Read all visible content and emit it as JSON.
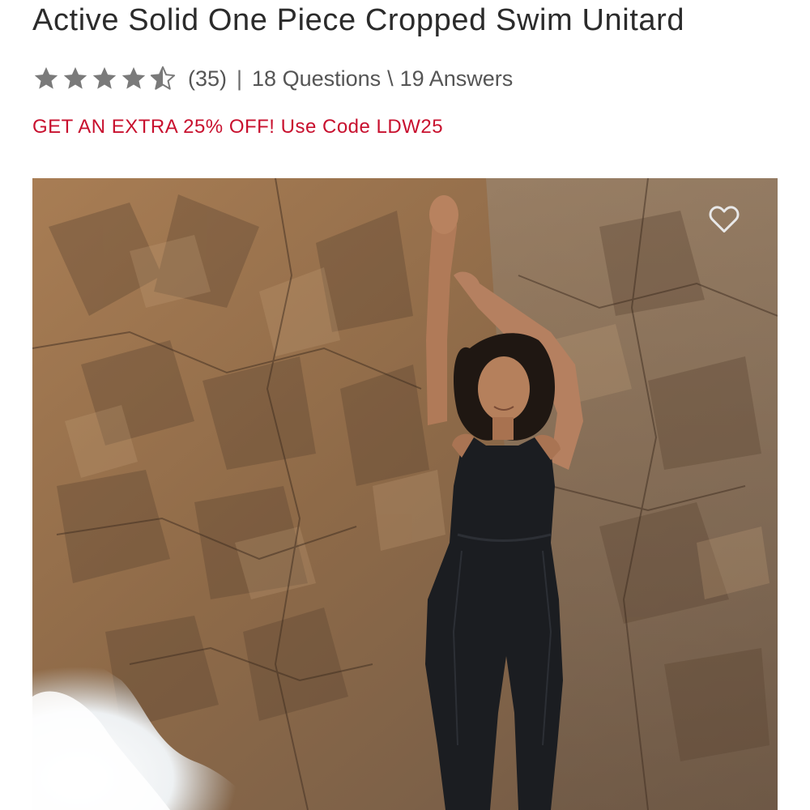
{
  "product": {
    "title": "Active Solid One Piece Cropped Swim Unitard"
  },
  "rating": {
    "stars": 4.5,
    "max_stars": 5,
    "count_label": "(35)",
    "separator": "|",
    "questions_label": "18 Questions",
    "qa_separator": "\\",
    "answers_label": "19 Answers"
  },
  "promo": {
    "text": "GET AN EXTRA 25% OFF! Use Code LDW25"
  },
  "colors": {
    "title": "#2b2b2b",
    "promo": "#c8102e",
    "star": "#7a7a7a",
    "meta_text": "#555555"
  },
  "icons": {
    "star": "star-icon",
    "half_star": "half-star-icon",
    "wishlist": "heart-outline-icon"
  }
}
